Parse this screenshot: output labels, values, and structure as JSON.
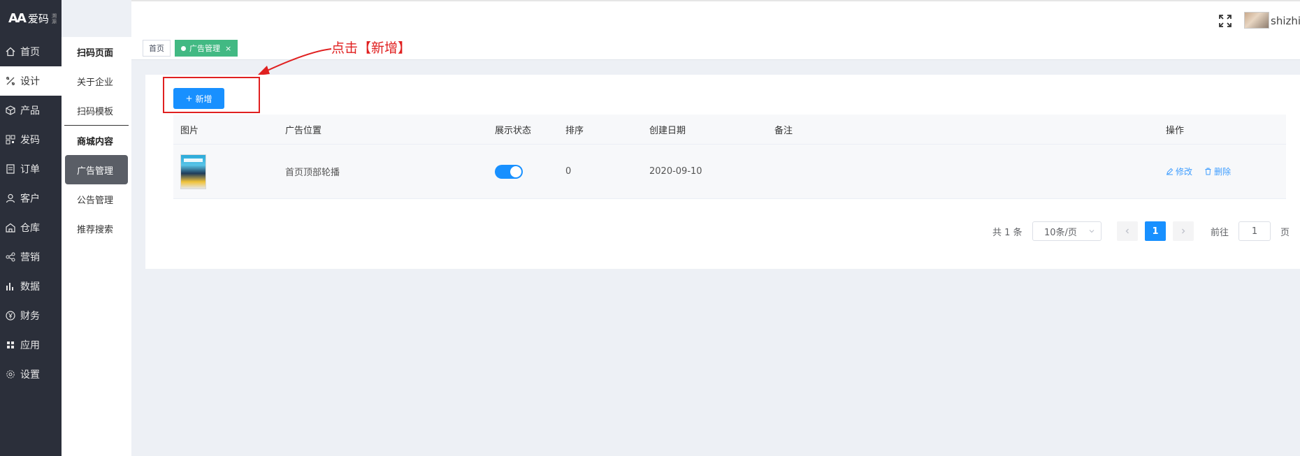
{
  "brand": {
    "name": "爱码",
    "mark": "AA",
    "sub": "溯源"
  },
  "nav": [
    {
      "label": "首页",
      "icon": "home-icon"
    },
    {
      "label": "设计",
      "icon": "design-icon"
    },
    {
      "label": "产品",
      "icon": "product-icon"
    },
    {
      "label": "发码",
      "icon": "qrcode-icon"
    },
    {
      "label": "订单",
      "icon": "order-icon"
    },
    {
      "label": "客户",
      "icon": "customer-icon"
    },
    {
      "label": "仓库",
      "icon": "warehouse-icon"
    },
    {
      "label": "营销",
      "icon": "share-icon"
    },
    {
      "label": "数据",
      "icon": "chart-icon"
    },
    {
      "label": "财务",
      "icon": "yen-icon"
    },
    {
      "label": "应用",
      "icon": "apps-icon"
    },
    {
      "label": "设置",
      "icon": "gear-icon"
    }
  ],
  "submenu": {
    "section1_title": "扫码页面",
    "section1_items": [
      "关于企业",
      "扫码模板"
    ],
    "section2_title": "商城内容",
    "section2_items": [
      "广告管理",
      "公告管理",
      "推荐搜索"
    ]
  },
  "header": {
    "username": "shizhi"
  },
  "tabs": {
    "home": "首页",
    "current": "广告管理",
    "close": "×"
  },
  "annotation": "点击【新增】",
  "toolbar": {
    "add_label": "新增"
  },
  "table": {
    "columns": [
      "图片",
      "广告位置",
      "展示状态",
      "排序",
      "创建日期",
      "备注",
      "操作"
    ],
    "rows": [
      {
        "position": "首页顶部轮播",
        "status_on": true,
        "sort": "0",
        "created": "2020-09-10",
        "note": "",
        "edit": "修改",
        "delete": "删除"
      }
    ]
  },
  "pagination": {
    "total": "共 1 条",
    "page_size": "10条/页",
    "current_page": "1",
    "goto_label": "前往",
    "goto_value": "1",
    "goto_unit": "页"
  },
  "colors": {
    "sidebar": "#2b2f3a",
    "primary": "#1890ff",
    "tag_active": "#42b983",
    "annotation": "#e02020"
  }
}
